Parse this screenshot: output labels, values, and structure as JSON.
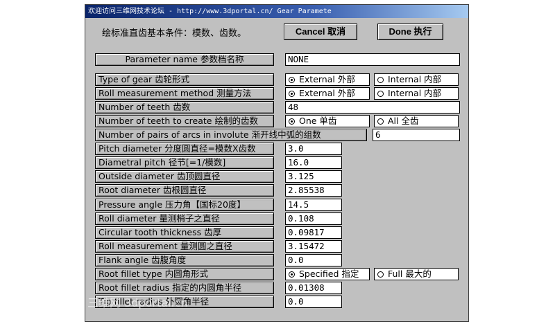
{
  "window": {
    "title": "欢迎访问三维网技术论坛 - http://www.3dportal.cn/ Gear Paramete"
  },
  "header": {
    "instruction": "绘标准直齿基本条件：模数、齿数。",
    "cancel_label": "Cancel 取消",
    "done_label": "Done 执行"
  },
  "param_name": {
    "label": "Parameter name 参数档名称",
    "value": "NONE"
  },
  "type_of_gear": {
    "label": "Type of gear   齿轮形式",
    "options": [
      "External 外部",
      "Internal 内部"
    ],
    "selected": "External 外部"
  },
  "roll_method": {
    "label": "Roll measurement method 测量方法",
    "options": [
      "External 外部",
      "Internal 内部"
    ],
    "selected": "External 外部"
  },
  "num_teeth": {
    "label": "Number of teeth 齿数",
    "value": "48"
  },
  "teeth_create": {
    "label": "Number of teeth to create 绘制的齿数",
    "options": [
      "One 单齿",
      "All 全齿"
    ],
    "selected": "One 单齿"
  },
  "arc_pairs": {
    "label": "Number of pairs of arcs in involute 渐开线中弧的组数",
    "value": "6"
  },
  "params": [
    {
      "label": "Pitch diameter 分度圆直径=模数X齿数",
      "value": "3.0"
    },
    {
      "label": "Diametral pitch    径节[=1/模数]",
      "value": "16.0"
    },
    {
      "label": "Outside diameter 齿顶圆直径",
      "value": "3.125"
    },
    {
      "label": "Root diameter     齿根圆直径",
      "value": "2.85538"
    },
    {
      "label": "Pressure angle    压力角【国标20度】",
      "value": "14.5"
    },
    {
      "label": "Roll diameter     量测梢子之直径",
      "value": "0.108"
    },
    {
      "label": "Circular tooth thickness 齿厚",
      "value": "0.09817"
    },
    {
      "label": "Roll measurement 量测圆之直径",
      "value": "3.15472"
    },
    {
      "label": "Flank angle 齿腹角度",
      "value": "0.0"
    }
  ],
  "root_fillet_type": {
    "label": "Root fillet type 内圆角形式",
    "options": [
      "Specified 指定",
      "Full 最大的"
    ],
    "selected": "Specified 指定"
  },
  "root_fillet_radius": {
    "label": "Root fillet radius 指定的内圆角半径",
    "value": "0.01308"
  },
  "tip_fillet_radius": {
    "label": "Tip fillet radius 外圆角半径",
    "value": "0.0"
  },
  "watermark": "三维网 3dportal.cn"
}
